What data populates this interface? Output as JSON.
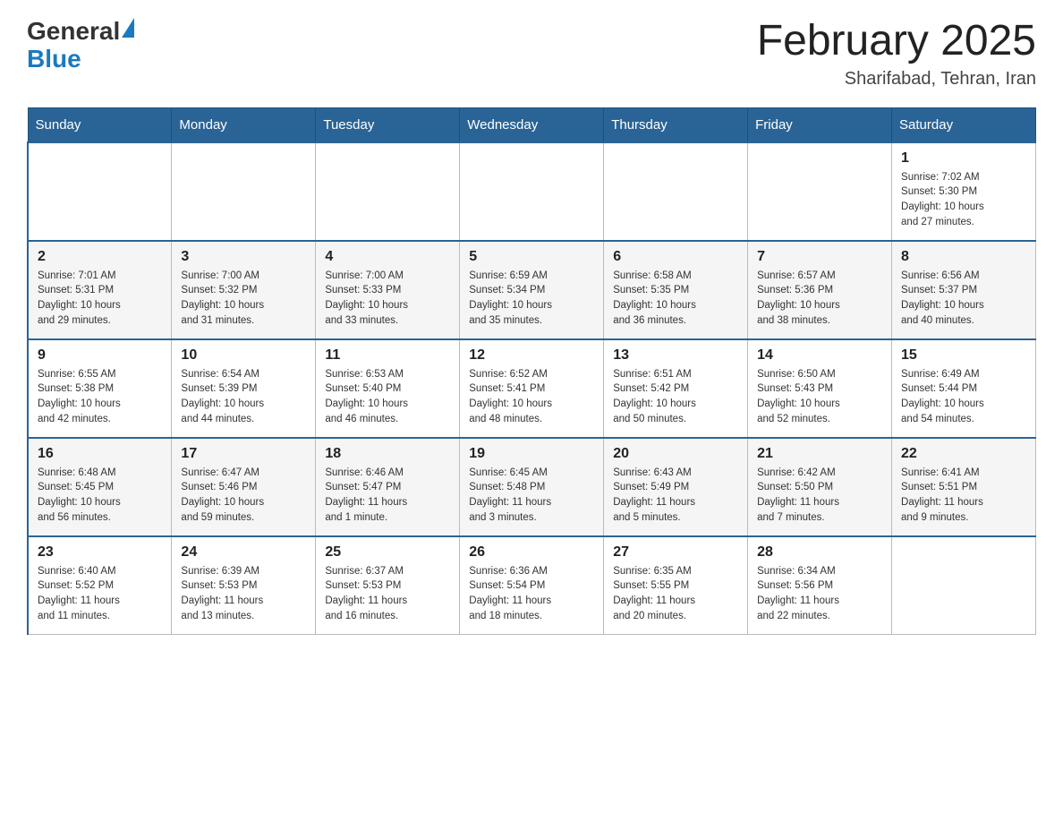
{
  "header": {
    "logo_general": "General",
    "logo_blue": "Blue",
    "month_title": "February 2025",
    "location": "Sharifabad, Tehran, Iran"
  },
  "days_of_week": [
    "Sunday",
    "Monday",
    "Tuesday",
    "Wednesday",
    "Thursday",
    "Friday",
    "Saturday"
  ],
  "weeks": [
    {
      "days": [
        {
          "number": "",
          "info": ""
        },
        {
          "number": "",
          "info": ""
        },
        {
          "number": "",
          "info": ""
        },
        {
          "number": "",
          "info": ""
        },
        {
          "number": "",
          "info": ""
        },
        {
          "number": "",
          "info": ""
        },
        {
          "number": "1",
          "info": "Sunrise: 7:02 AM\nSunset: 5:30 PM\nDaylight: 10 hours\nand 27 minutes."
        }
      ]
    },
    {
      "days": [
        {
          "number": "2",
          "info": "Sunrise: 7:01 AM\nSunset: 5:31 PM\nDaylight: 10 hours\nand 29 minutes."
        },
        {
          "number": "3",
          "info": "Sunrise: 7:00 AM\nSunset: 5:32 PM\nDaylight: 10 hours\nand 31 minutes."
        },
        {
          "number": "4",
          "info": "Sunrise: 7:00 AM\nSunset: 5:33 PM\nDaylight: 10 hours\nand 33 minutes."
        },
        {
          "number": "5",
          "info": "Sunrise: 6:59 AM\nSunset: 5:34 PM\nDaylight: 10 hours\nand 35 minutes."
        },
        {
          "number": "6",
          "info": "Sunrise: 6:58 AM\nSunset: 5:35 PM\nDaylight: 10 hours\nand 36 minutes."
        },
        {
          "number": "7",
          "info": "Sunrise: 6:57 AM\nSunset: 5:36 PM\nDaylight: 10 hours\nand 38 minutes."
        },
        {
          "number": "8",
          "info": "Sunrise: 6:56 AM\nSunset: 5:37 PM\nDaylight: 10 hours\nand 40 minutes."
        }
      ]
    },
    {
      "days": [
        {
          "number": "9",
          "info": "Sunrise: 6:55 AM\nSunset: 5:38 PM\nDaylight: 10 hours\nand 42 minutes."
        },
        {
          "number": "10",
          "info": "Sunrise: 6:54 AM\nSunset: 5:39 PM\nDaylight: 10 hours\nand 44 minutes."
        },
        {
          "number": "11",
          "info": "Sunrise: 6:53 AM\nSunset: 5:40 PM\nDaylight: 10 hours\nand 46 minutes."
        },
        {
          "number": "12",
          "info": "Sunrise: 6:52 AM\nSunset: 5:41 PM\nDaylight: 10 hours\nand 48 minutes."
        },
        {
          "number": "13",
          "info": "Sunrise: 6:51 AM\nSunset: 5:42 PM\nDaylight: 10 hours\nand 50 minutes."
        },
        {
          "number": "14",
          "info": "Sunrise: 6:50 AM\nSunset: 5:43 PM\nDaylight: 10 hours\nand 52 minutes."
        },
        {
          "number": "15",
          "info": "Sunrise: 6:49 AM\nSunset: 5:44 PM\nDaylight: 10 hours\nand 54 minutes."
        }
      ]
    },
    {
      "days": [
        {
          "number": "16",
          "info": "Sunrise: 6:48 AM\nSunset: 5:45 PM\nDaylight: 10 hours\nand 56 minutes."
        },
        {
          "number": "17",
          "info": "Sunrise: 6:47 AM\nSunset: 5:46 PM\nDaylight: 10 hours\nand 59 minutes."
        },
        {
          "number": "18",
          "info": "Sunrise: 6:46 AM\nSunset: 5:47 PM\nDaylight: 11 hours\nand 1 minute."
        },
        {
          "number": "19",
          "info": "Sunrise: 6:45 AM\nSunset: 5:48 PM\nDaylight: 11 hours\nand 3 minutes."
        },
        {
          "number": "20",
          "info": "Sunrise: 6:43 AM\nSunset: 5:49 PM\nDaylight: 11 hours\nand 5 minutes."
        },
        {
          "number": "21",
          "info": "Sunrise: 6:42 AM\nSunset: 5:50 PM\nDaylight: 11 hours\nand 7 minutes."
        },
        {
          "number": "22",
          "info": "Sunrise: 6:41 AM\nSunset: 5:51 PM\nDaylight: 11 hours\nand 9 minutes."
        }
      ]
    },
    {
      "days": [
        {
          "number": "23",
          "info": "Sunrise: 6:40 AM\nSunset: 5:52 PM\nDaylight: 11 hours\nand 11 minutes."
        },
        {
          "number": "24",
          "info": "Sunrise: 6:39 AM\nSunset: 5:53 PM\nDaylight: 11 hours\nand 13 minutes."
        },
        {
          "number": "25",
          "info": "Sunrise: 6:37 AM\nSunset: 5:53 PM\nDaylight: 11 hours\nand 16 minutes."
        },
        {
          "number": "26",
          "info": "Sunrise: 6:36 AM\nSunset: 5:54 PM\nDaylight: 11 hours\nand 18 minutes."
        },
        {
          "number": "27",
          "info": "Sunrise: 6:35 AM\nSunset: 5:55 PM\nDaylight: 11 hours\nand 20 minutes."
        },
        {
          "number": "28",
          "info": "Sunrise: 6:34 AM\nSunset: 5:56 PM\nDaylight: 11 hours\nand 22 minutes."
        },
        {
          "number": "",
          "info": ""
        }
      ]
    }
  ]
}
